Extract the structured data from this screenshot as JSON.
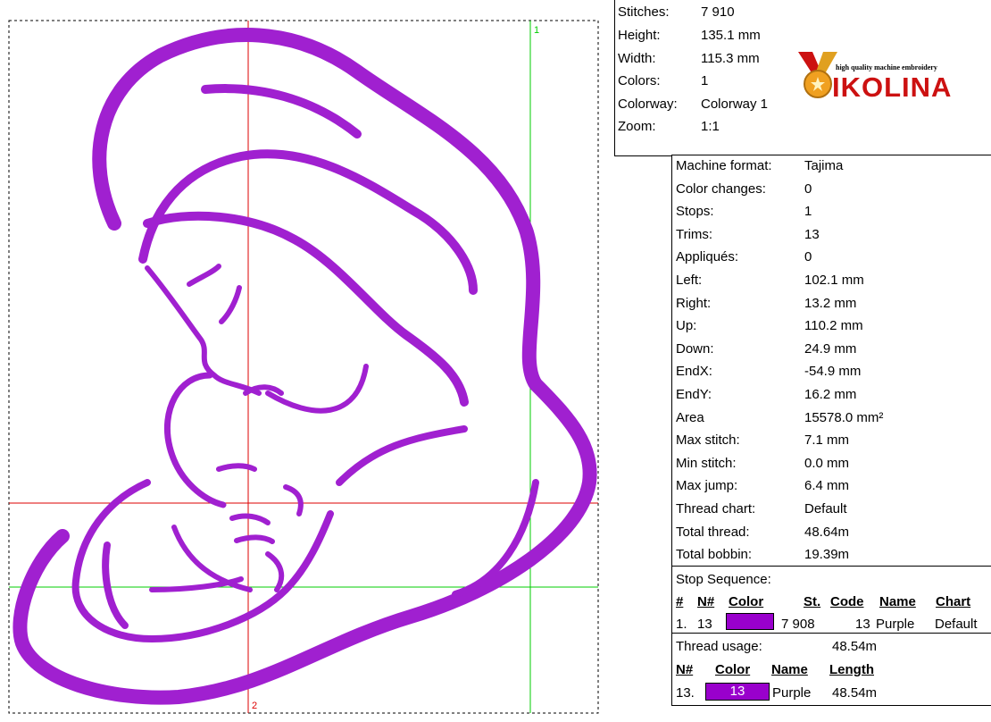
{
  "summary": {
    "stitches_label": "Stitches:",
    "stitches": "7 910",
    "height_label": "Height:",
    "height": "135.1 mm",
    "width_label": "Width:",
    "width": "115.3 mm",
    "colors_label": "Colors:",
    "colors": "1",
    "colorway_label": "Colorway:",
    "colorway": "Colorway 1",
    "zoom_label": "Zoom:",
    "zoom": "1:1"
  },
  "logo": {
    "brand": "IKOLINA",
    "tagline": "high quality machine embroidery",
    "brand_color": "#cc1111",
    "medal_color": "#f0a020"
  },
  "details": [
    {
      "label": "Machine format:",
      "value": "Tajima"
    },
    {
      "label": "Color changes:",
      "value": "0"
    },
    {
      "label": "Stops:",
      "value": "1"
    },
    {
      "label": "Trims:",
      "value": "13"
    },
    {
      "label": "Appliqués:",
      "value": "0"
    },
    {
      "label": "Left:",
      "value": "102.1 mm"
    },
    {
      "label": "Right:",
      "value": "13.2 mm"
    },
    {
      "label": "Up:",
      "value": "110.2 mm"
    },
    {
      "label": "Down:",
      "value": "24.9 mm"
    },
    {
      "label": "EndX:",
      "value": "-54.9 mm"
    },
    {
      "label": "EndY:",
      "value": "16.2 mm"
    },
    {
      "label": "Area",
      "value": "15578.0 mm²"
    },
    {
      "label": "Max stitch:",
      "value": "7.1 mm"
    },
    {
      "label": "Min stitch:",
      "value": "0.0 mm"
    },
    {
      "label": "Max jump:",
      "value": "6.4 mm"
    },
    {
      "label": "Thread chart:",
      "value": "Default"
    },
    {
      "label": "Total thread:",
      "value": "48.64m"
    },
    {
      "label": "Total bobbin:",
      "value": "19.39m"
    }
  ],
  "stop_sequence": {
    "title": "Stop Sequence:",
    "headers": {
      "num": "#",
      "n": "N#",
      "color": "Color",
      "st": "St.",
      "code": "Code",
      "name": "Name",
      "chart": "Chart"
    },
    "row": {
      "num": "1.",
      "n": "13",
      "st": "7 908",
      "code": "13",
      "name": "Purple",
      "chart": "Default",
      "swatch": "#9900cc"
    }
  },
  "thread_usage": {
    "title": "Thread usage:",
    "total": "48.54m",
    "headers": {
      "n": "N#",
      "color": "Color",
      "name": "Name",
      "length": "Length"
    },
    "row": {
      "n": "13.",
      "color": "13",
      "name": "Purple",
      "length": "48.54m",
      "swatch": "#9900cc"
    }
  },
  "preview": {
    "guide_label_1": "1",
    "guide_label_2": "2",
    "thread_color": "#a020d0",
    "guide_red": "#dd0000",
    "guide_green": "#00cc00"
  }
}
